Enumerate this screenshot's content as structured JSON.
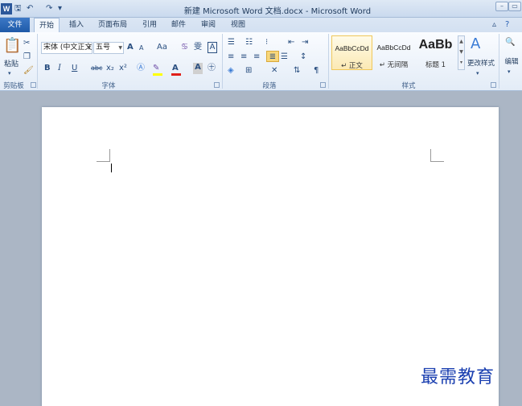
{
  "window": {
    "app_icon": "W",
    "title": "新建 Microsoft Word 文档.docx - Microsoft Word",
    "quick_access": {
      "save": "🖫",
      "undo": "↶",
      "redo": "↷",
      "customize": "▾"
    }
  },
  "tabs": [
    {
      "label": "文件"
    },
    {
      "label": "开始"
    },
    {
      "label": "插入"
    },
    {
      "label": "页面布局"
    },
    {
      "label": "引用"
    },
    {
      "label": "邮件"
    },
    {
      "label": "审阅"
    },
    {
      "label": "视图"
    }
  ],
  "ribbon": {
    "clipboard": {
      "paste_label": "粘贴",
      "group_label": "剪贴板"
    },
    "font": {
      "font_name": "宋体 (中文正文)",
      "font_size": "五号",
      "group_label": "字体",
      "grow": "A",
      "shrink": "A",
      "change_case": "Aa",
      "bold": "B",
      "italic": "I",
      "underline": "U",
      "strike": "abc",
      "subscript": "x₂",
      "superscript": "x²",
      "highlight_color": "#ffff00",
      "font_color": "#e0201a"
    },
    "paragraph": {
      "group_label": "段落"
    },
    "styles": {
      "group_label": "样式",
      "items": [
        {
          "sample": "AaBbCcDd",
          "name": "↵ 正文"
        },
        {
          "sample": "AaBbCcDd",
          "name": "↵ 无间隔"
        },
        {
          "sample": "AaBb",
          "name": "标题 1"
        }
      ],
      "change_styles_label": "更改样式"
    },
    "editing": {
      "label": "编辑"
    }
  },
  "watermark": "最需教育",
  "colors": {
    "file_tab": "#2b62b4",
    "accent": "#2b579a",
    "style_selected_border": "#f0c85a"
  }
}
